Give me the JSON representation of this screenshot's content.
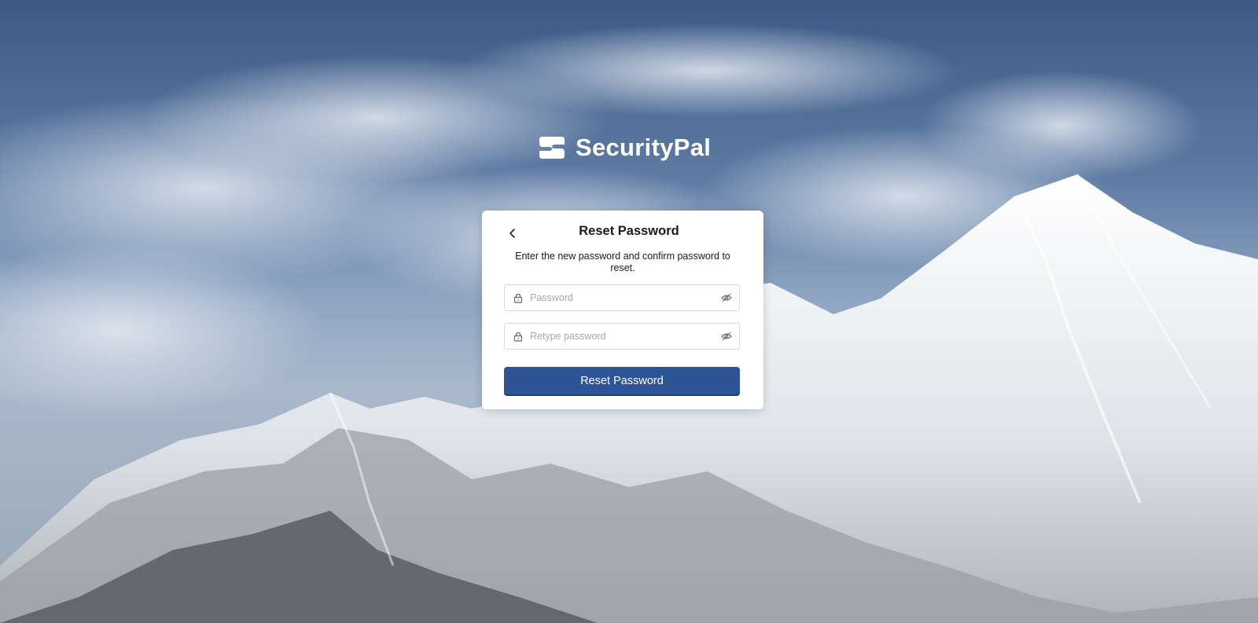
{
  "brand": {
    "name": "SecurityPal",
    "logo_icon": "securitypal-logo-icon"
  },
  "card": {
    "back_icon": "chevron-left-icon",
    "title": "Reset Password",
    "description": "Enter the new password and confirm password to reset.",
    "password_field": {
      "placeholder": "Password",
      "value": "",
      "lead_icon": "lock-icon",
      "trail_icon": "eye-hidden-icon"
    },
    "retype_field": {
      "placeholder": "Retype password",
      "value": "",
      "lead_icon": "lock-icon",
      "trail_icon": "eye-hidden-icon"
    },
    "submit_label": "Reset Password"
  },
  "colors": {
    "primary_button": "#2d5496",
    "card_background": "#ffffff"
  }
}
